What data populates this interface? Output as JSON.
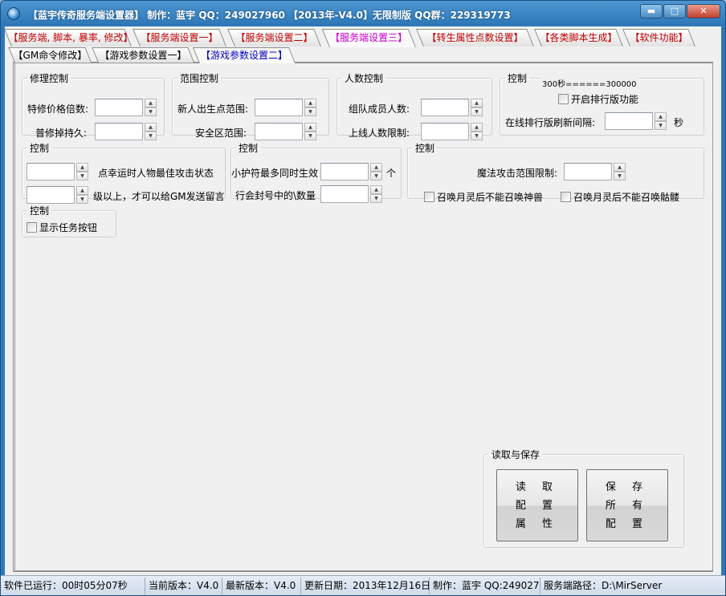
{
  "window": {
    "title": "【蓝宇传奇服务端设置器】 制作：蓝宇 QQ：249027960 【2013年-V4.0】无限制版 QQ群：229319773",
    "minimize_glyph": "▬",
    "maximize_glyph": "□",
    "close_glyph": "✕"
  },
  "tabs_main": [
    {
      "label": "【服务端, 脚本, 暴率, 修改】"
    },
    {
      "label": "【服务端设置一】"
    },
    {
      "label": "【服务端设置二】"
    },
    {
      "label": "【服务端设置三】"
    },
    {
      "label": "【转生属性点数设置】"
    },
    {
      "label": "【各类脚本生成】"
    },
    {
      "label": "【软件功能】"
    }
  ],
  "tabs_sub": [
    {
      "label": "【GM命令修改】"
    },
    {
      "label": "【游戏参数设置一】"
    },
    {
      "label": "【游戏参数设置二】"
    }
  ],
  "repair": {
    "legend": "修理控制",
    "special_label": "特修价格倍数:",
    "normal_label": "普修掉持久:",
    "special_value": "",
    "normal_value": ""
  },
  "range": {
    "legend": "范围控制",
    "spawn_label": "新人出生点范围:",
    "safe_label": "安全区范围:",
    "spawn_value": "",
    "safe_value": ""
  },
  "people": {
    "legend": "人数控制",
    "team_label": "组队成员人数:",
    "online_label": "上线人数限制:",
    "team_value": "",
    "online_value": ""
  },
  "ranking": {
    "legend": "控制",
    "note": "300秒======300000",
    "enable_label": "开启排行版功能",
    "refresh_label": "在线排行版刷新间隔:",
    "refresh_value": "",
    "unit": "秒"
  },
  "control1": {
    "legend": "控制",
    "luck_label": "点幸运时人物最佳攻击状态",
    "level_label": "级以上，才可以给GM发送留言",
    "luck_value": "",
    "level_value": ""
  },
  "control2": {
    "legend": "控制",
    "amulet_label": "小护符最多同时生效",
    "amulet_unit": "个",
    "guild_label": "行会封号中的\\数量",
    "amulet_value": "",
    "guild_value": ""
  },
  "control3": {
    "legend": "控制",
    "magic_label": "魔法攻击范围限制:",
    "magic_value": "",
    "beast_label": "召唤月灵后不能召唤神兽",
    "skeleton_label": "召唤月灵后不能召唤骷髅"
  },
  "control4": {
    "legend": "控制",
    "task_label": "显示任务按钮"
  },
  "save": {
    "legend": "读取与保存",
    "read_lines": [
      "读 取",
      "配 置",
      "属 性"
    ],
    "save_lines": [
      "保 存",
      "所 有",
      "配 置"
    ]
  },
  "status": {
    "runtime": "软件已运行：00时05分07秒",
    "current": "当前版本：V4.0",
    "latest": "最新版本：V4.0",
    "update": "更新日期：2013年12月16日",
    "author": "制作：蓝宇 QQ:249027960",
    "path": "服务端路径：D:\\MirServer"
  }
}
